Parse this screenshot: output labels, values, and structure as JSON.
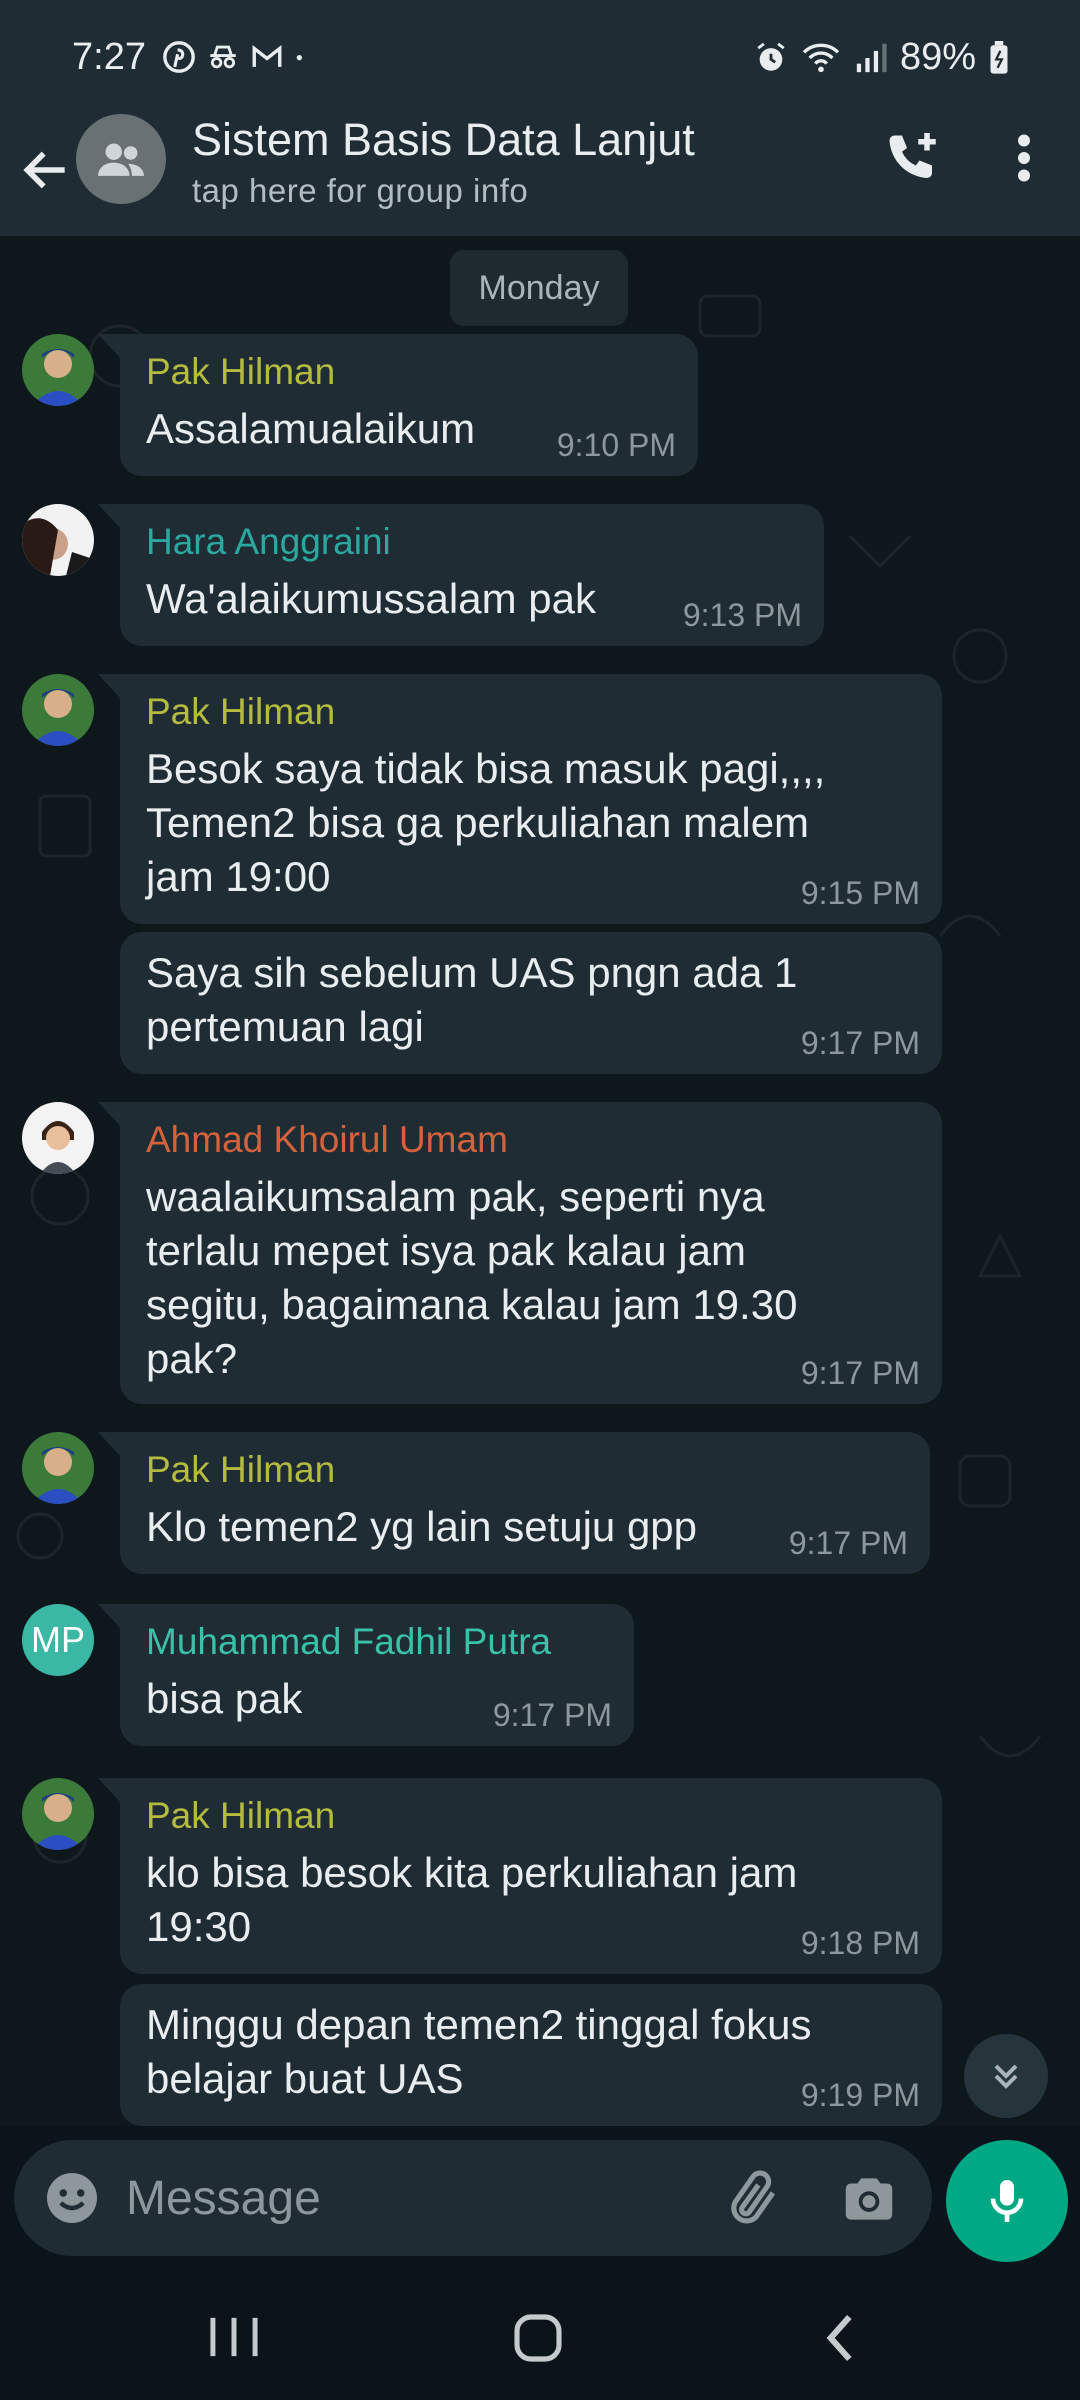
{
  "status_bar": {
    "time": "7:27",
    "battery": "89%"
  },
  "header": {
    "title": "Sistem Basis Data Lanjut",
    "subtitle": "tap here for group info"
  },
  "chat": {
    "day_label": "Monday",
    "messages": [
      {
        "sender": "Pak Hilman",
        "sender_color": "#b5bb3f",
        "text": "Assalamualaikum",
        "time": "9:10 PM"
      },
      {
        "sender": "Hara Anggraini",
        "sender_color": "#2ba8a0",
        "text": "Wa'alaikumussalam pak",
        "time": "9:13 PM"
      },
      {
        "sender": "Pak Hilman",
        "sender_color": "#b5bb3f",
        "text": "Besok saya tidak bisa masuk pagi,,,,\nTemen2 bisa ga perkuliahan malem\njam 19:00",
        "time": "9:15 PM"
      },
      {
        "sender": "",
        "text": "Saya sih sebelum UAS pngn ada 1\npertemuan lagi",
        "time": "9:17 PM"
      },
      {
        "sender": "Ahmad Khoirul Umam",
        "sender_color": "#d4623b",
        "text": "waalaikumsalam pak, seperti nya\nterlalu mepet isya pak kalau jam\nsegitu, bagaimana kalau jam 19.30\npak?",
        "time": "9:17 PM"
      },
      {
        "sender": "Pak Hilman",
        "sender_color": "#b5bb3f",
        "text": "Klo temen2 yg lain setuju gpp",
        "time": "9:17 PM"
      },
      {
        "sender": "Muhammad Fadhil Putra",
        "sender_color": "#39c2a8",
        "avatar_initials": "MP",
        "text": "bisa pak",
        "time": "9:17 PM"
      },
      {
        "sender": "Pak Hilman",
        "sender_color": "#b5bb3f",
        "text": "klo bisa besok kita perkuliahan jam\n19:30",
        "time": "9:18 PM"
      },
      {
        "sender": "",
        "text": "Minggu depan temen2 tinggal fokus\nbelajar buat UAS",
        "time": "9:19 PM"
      }
    ]
  },
  "input": {
    "placeholder": "Message"
  },
  "icons": {
    "back": "arrow-left-icon",
    "group_avatar": "group-icon",
    "call_add": "add-call-icon",
    "more": "more-vert-icon",
    "emoji": "emoji-icon",
    "attach": "paperclip-icon",
    "camera": "camera-icon",
    "mic": "mic-icon",
    "scroll_down": "double-chevron-down-icon"
  },
  "colors": {
    "accent": "#00a884",
    "bubble": "#1f2c34",
    "background": "#0b141a"
  }
}
